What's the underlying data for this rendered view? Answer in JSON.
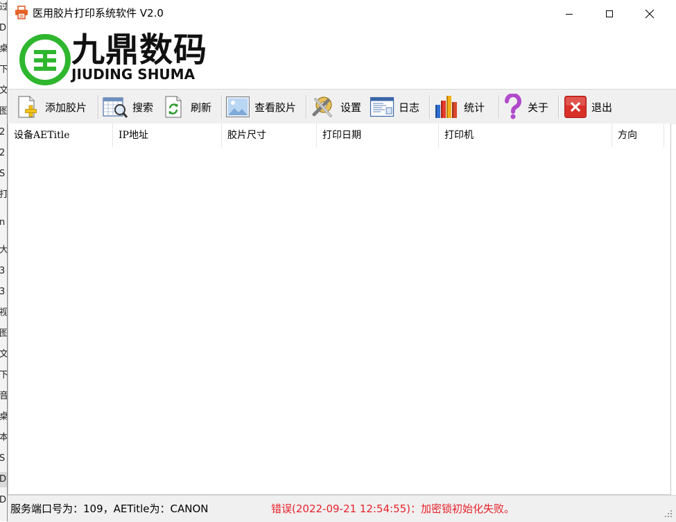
{
  "window": {
    "title": "医用胶片打印系统软件 V2.0",
    "controls": {
      "minimize": "minimize",
      "maximize": "maximize",
      "close": "close"
    }
  },
  "background_strip": [
    "过",
    "D",
    "桌",
    "下",
    "文",
    "图",
    "2",
    "2",
    "S",
    "打",
    "",
    "n",
    "大",
    "3",
    "3",
    "视",
    "图",
    "文",
    "下",
    "音",
    "桌",
    "本",
    "S",
    "D",
    "D"
  ],
  "logo": {
    "chinese": "九鼎数码",
    "english": "JIUDING SHUMA",
    "accent": "#2fb62f"
  },
  "toolbar": {
    "buttons": [
      {
        "label": "添加胶片",
        "icon": "add-film-icon"
      },
      {
        "label": "搜索",
        "icon": "search-calendar-icon"
      },
      {
        "label": "刷新",
        "icon": "refresh-icon"
      },
      {
        "label": "查看胶片",
        "icon": "view-image-icon"
      },
      {
        "label": "设置",
        "icon": "settings-tools-icon"
      },
      {
        "label": "日志",
        "icon": "log-window-icon"
      },
      {
        "label": "统计",
        "icon": "bar-chart-icon"
      },
      {
        "label": "关于",
        "icon": "question-icon"
      },
      {
        "label": "退出",
        "icon": "exit-x-icon"
      }
    ]
  },
  "table": {
    "columns": [
      "设备AETitle",
      "IP地址",
      "胶片尺寸",
      "打印日期",
      "打印机",
      "方向"
    ],
    "rows": []
  },
  "status": {
    "port_info": "服务端口号为：109，AETitle为：CANON",
    "error": "错误(2022-09-21 12:54:55)：加密锁初始化失败。",
    "error_color": "#e8202a"
  }
}
